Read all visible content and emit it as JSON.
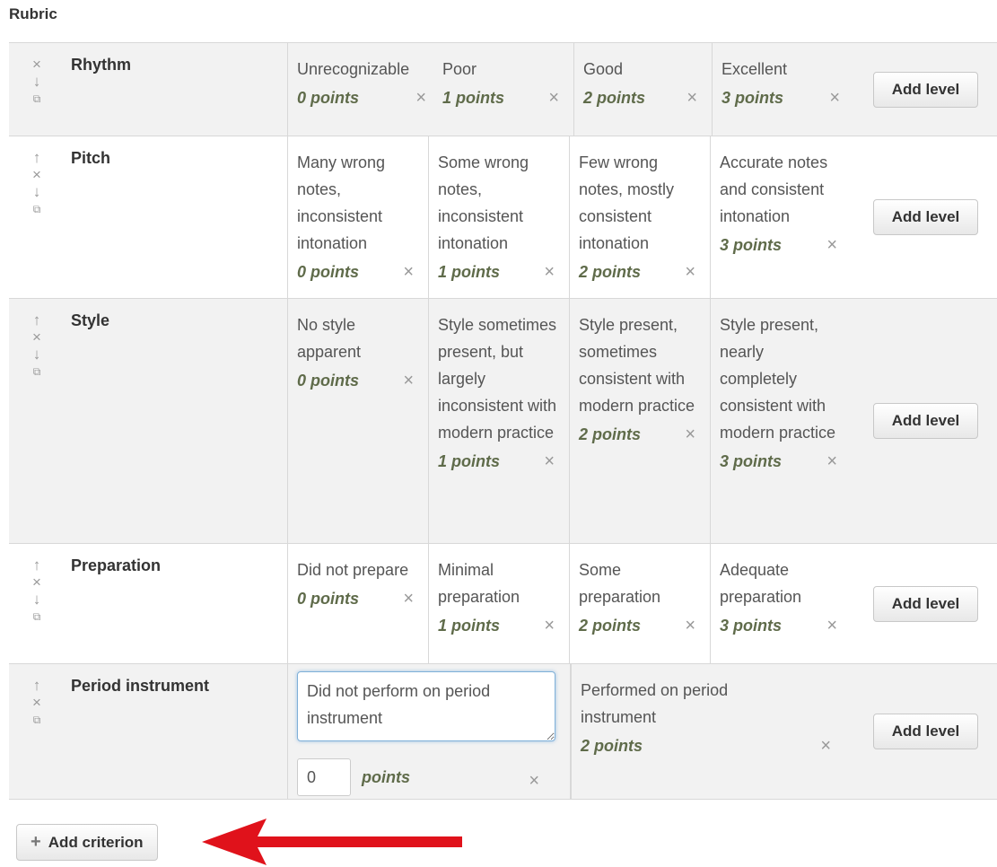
{
  "heading": "Rubric",
  "criteria": [
    {
      "name": "Rhythm",
      "levels": [
        {
          "text": "Unrecognizable",
          "points": "0 points"
        },
        {
          "text": "Poor",
          "points": "1 points"
        },
        {
          "text": "Good",
          "points": "2 points"
        },
        {
          "text": "Excellent",
          "points": "3 points"
        }
      ]
    },
    {
      "name": "Pitch",
      "levels": [
        {
          "text": "Many wrong notes, inconsistent intonation",
          "points": "0 points"
        },
        {
          "text": "Some wrong notes, inconsistent intonation",
          "points": "1 points"
        },
        {
          "text": "Few wrong notes, mostly consistent intonation",
          "points": "2 points"
        },
        {
          "text": "Accurate notes and consistent intonation",
          "points": "3 points"
        }
      ]
    },
    {
      "name": "Style",
      "levels": [
        {
          "text": "No style apparent",
          "points": "0 points"
        },
        {
          "text": "Style sometimes present, but largely inconsistent with modern practice",
          "points": "1 points"
        },
        {
          "text": "Style present, sometimes consistent with modern practice",
          "points": "2 points"
        },
        {
          "text": "Style present, nearly completely consistent with modern practice",
          "points": "3 points"
        }
      ]
    },
    {
      "name": "Preparation",
      "levels": [
        {
          "text": "Did not prepare",
          "points": "0 points"
        },
        {
          "text": "Minimal preparation",
          "points": "1 points"
        },
        {
          "text": "Some preparation",
          "points": "2 points"
        },
        {
          "text": "Adequate preparation",
          "points": "3 points"
        }
      ]
    },
    {
      "name": "Period instrument",
      "editing": {
        "value": "Did not perform on period instrument",
        "points_value": "0",
        "points_label": "points"
      },
      "levels": [
        {
          "text": "Performed on period instrument",
          "points": "2 points"
        }
      ]
    }
  ],
  "add_level_label": "Add level",
  "add_criterion_label": "Add criterion",
  "icons": {
    "delete": "×",
    "move_up": "↑",
    "move_down": "↓",
    "duplicate": "copy",
    "plus": "+"
  },
  "colors": {
    "points_text": "#5f6b4a",
    "arrow": "#e0121b",
    "row_grey": "#f2f2f2"
  }
}
